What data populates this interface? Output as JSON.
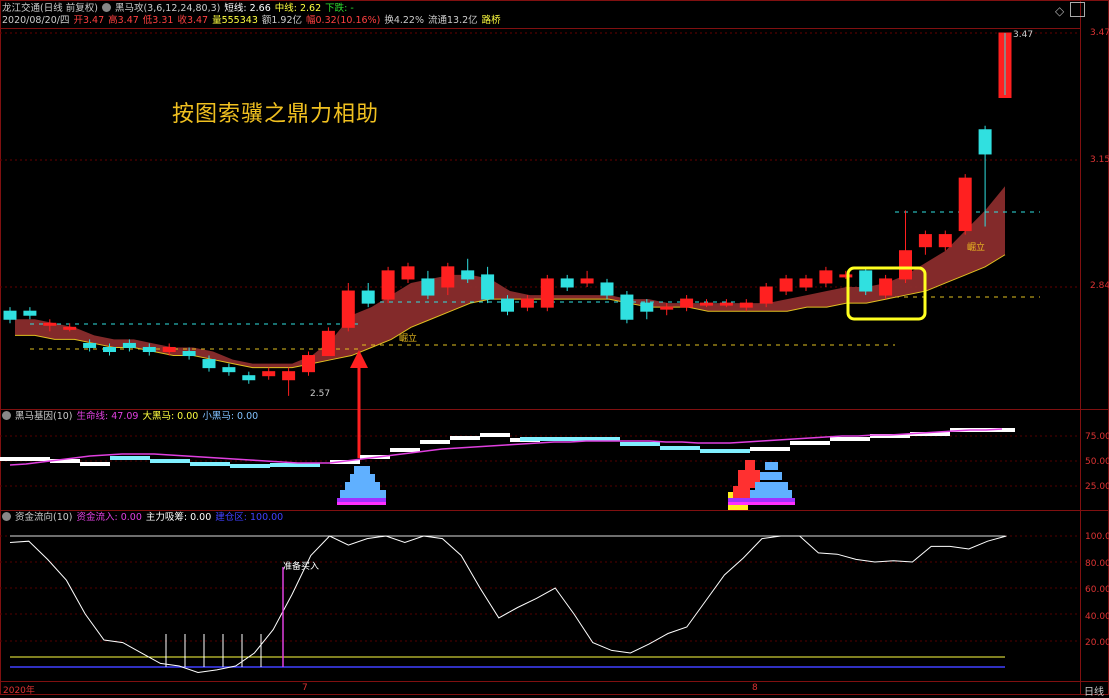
{
  "header": {
    "title": "龙江交通(日线 前复权)",
    "indicator": "黑马攻(3,6,12,24,80,3)",
    "short_line": "短线: 2.66",
    "mid_line": "中线: 2.62",
    "trend": "下跌: -",
    "date": "2020/08/20/四",
    "open": "开3.47",
    "high": "高3.47",
    "low": "低3.31",
    "close": "收3.47",
    "volume": "量555343",
    "amount": "额1.92亿",
    "amp": "幅0.32(10.16%)",
    "turnover": "换4.22%",
    "float": "流通13.2亿",
    "extra": "路桥"
  },
  "annotation": "按图索骥之鼎力相助",
  "price_axis": [
    "3.47",
    "3.15",
    "2.84"
  ],
  "price_labels": {
    "high": "3.47",
    "low": "2.57",
    "rise1": "崛立",
    "rise2": "崛立"
  },
  "panel2": {
    "title": "黑马基因(10)",
    "l1": "生命线: 47.09",
    "l2": "大黑马: 0.00",
    "l3": "小黑马: 0.00",
    "axis": [
      "75.00",
      "50.00",
      "25.00"
    ]
  },
  "panel3": {
    "title": "资金流向(10)",
    "l1": "资金流入: 0.00",
    "l2": "主力吸筹: 0.00",
    "l3": "建仓区: 100.00",
    "axis": [
      "100.00",
      "80.00",
      "60.00",
      "40.00",
      "20.00"
    ],
    "note": "准备买入"
  },
  "x_axis": [
    "2020年",
    "7",
    "8"
  ],
  "period_label": "日线",
  "colors": {
    "up": "#ff2020",
    "down": "#30e0e0",
    "ma": "#a04040",
    "grid": "#801010"
  },
  "chart_data": {
    "type": "candlestick",
    "ylim": [
      2.45,
      3.5
    ],
    "candles": [
      {
        "o": 2.78,
        "c": 2.76,
        "h": 2.79,
        "l": 2.75
      },
      {
        "o": 2.78,
        "c": 2.77,
        "h": 2.79,
        "l": 2.76
      },
      {
        "o": 2.75,
        "c": 2.75,
        "h": 2.76,
        "l": 2.73
      },
      {
        "o": 2.74,
        "c": 2.74,
        "h": 2.75,
        "l": 2.73
      },
      {
        "o": 2.7,
        "c": 2.69,
        "h": 2.71,
        "l": 2.68
      },
      {
        "o": 2.69,
        "c": 2.68,
        "h": 2.7,
        "l": 2.67
      },
      {
        "o": 2.7,
        "c": 2.69,
        "h": 2.71,
        "l": 2.68
      },
      {
        "o": 2.69,
        "c": 2.68,
        "h": 2.7,
        "l": 2.67
      },
      {
        "o": 2.68,
        "c": 2.69,
        "h": 2.7,
        "l": 2.67
      },
      {
        "o": 2.68,
        "c": 2.67,
        "h": 2.69,
        "l": 2.66
      },
      {
        "o": 2.66,
        "c": 2.64,
        "h": 2.67,
        "l": 2.63
      },
      {
        "o": 2.64,
        "c": 2.63,
        "h": 2.65,
        "l": 2.62
      },
      {
        "o": 2.62,
        "c": 2.61,
        "h": 2.63,
        "l": 2.6
      },
      {
        "o": 2.62,
        "c": 2.63,
        "h": 2.64,
        "l": 2.61
      },
      {
        "o": 2.61,
        "c": 2.63,
        "h": 2.64,
        "l": 2.57
      },
      {
        "o": 2.63,
        "c": 2.67,
        "h": 2.68,
        "l": 2.62
      },
      {
        "o": 2.67,
        "c": 2.73,
        "h": 2.74,
        "l": 2.67
      },
      {
        "o": 2.74,
        "c": 2.83,
        "h": 2.85,
        "l": 2.73
      },
      {
        "o": 2.83,
        "c": 2.8,
        "h": 2.85,
        "l": 2.79
      },
      {
        "o": 2.81,
        "c": 2.88,
        "h": 2.89,
        "l": 2.8
      },
      {
        "o": 2.86,
        "c": 2.89,
        "h": 2.9,
        "l": 2.85
      },
      {
        "o": 2.86,
        "c": 2.82,
        "h": 2.88,
        "l": 2.81
      },
      {
        "o": 2.84,
        "c": 2.89,
        "h": 2.9,
        "l": 2.82
      },
      {
        "o": 2.88,
        "c": 2.86,
        "h": 2.91,
        "l": 2.85
      },
      {
        "o": 2.87,
        "c": 2.81,
        "h": 2.89,
        "l": 2.8
      },
      {
        "o": 2.81,
        "c": 2.78,
        "h": 2.82,
        "l": 2.77
      },
      {
        "o": 2.79,
        "c": 2.81,
        "h": 2.82,
        "l": 2.78
      },
      {
        "o": 2.79,
        "c": 2.86,
        "h": 2.87,
        "l": 2.78
      },
      {
        "o": 2.86,
        "c": 2.84,
        "h": 2.87,
        "l": 2.83
      },
      {
        "o": 2.85,
        "c": 2.86,
        "h": 2.88,
        "l": 2.84
      },
      {
        "o": 2.85,
        "c": 2.82,
        "h": 2.86,
        "l": 2.81
      },
      {
        "o": 2.82,
        "c": 2.76,
        "h": 2.83,
        "l": 2.75
      },
      {
        "o": 2.8,
        "c": 2.78,
        "h": 2.81,
        "l": 2.76
      },
      {
        "o": 2.79,
        "c": 2.79,
        "h": 2.8,
        "l": 2.77
      },
      {
        "o": 2.79,
        "c": 2.81,
        "h": 2.82,
        "l": 2.78
      },
      {
        "o": 2.8,
        "c": 2.8,
        "h": 2.81,
        "l": 2.79
      },
      {
        "o": 2.8,
        "c": 2.8,
        "h": 2.81,
        "l": 2.79
      },
      {
        "o": 2.79,
        "c": 2.8,
        "h": 2.81,
        "l": 2.78
      },
      {
        "o": 2.8,
        "c": 2.84,
        "h": 2.85,
        "l": 2.79
      },
      {
        "o": 2.83,
        "c": 2.86,
        "h": 2.87,
        "l": 2.82
      },
      {
        "o": 2.84,
        "c": 2.86,
        "h": 2.87,
        "l": 2.83
      },
      {
        "o": 2.85,
        "c": 2.88,
        "h": 2.89,
        "l": 2.84
      },
      {
        "o": 2.87,
        "c": 2.87,
        "h": 2.88,
        "l": 2.86
      },
      {
        "o": 2.88,
        "c": 2.83,
        "h": 2.89,
        "l": 2.82
      },
      {
        "o": 2.82,
        "c": 2.86,
        "h": 2.87,
        "l": 2.81
      },
      {
        "o": 2.86,
        "c": 2.93,
        "h": 3.03,
        "l": 2.85
      },
      {
        "o": 2.94,
        "c": 2.97,
        "h": 2.98,
        "l": 2.92
      },
      {
        "o": 2.94,
        "c": 2.97,
        "h": 2.98,
        "l": 2.93
      },
      {
        "o": 2.98,
        "c": 3.11,
        "h": 3.12,
        "l": 2.97
      },
      {
        "o": 3.23,
        "c": 3.17,
        "h": 3.24,
        "l": 2.99
      },
      {
        "o": 3.31,
        "c": 3.47,
        "h": 3.47,
        "l": 3.31
      }
    ],
    "rise_band": [
      [
        2.76,
        2.72
      ],
      [
        2.76,
        2.72
      ],
      [
        2.75,
        2.71
      ],
      [
        2.74,
        2.71
      ],
      [
        2.72,
        2.7
      ],
      [
        2.71,
        2.69
      ],
      [
        2.71,
        2.69
      ],
      [
        2.7,
        2.68
      ],
      [
        2.69,
        2.67
      ],
      [
        2.69,
        2.67
      ],
      [
        2.68,
        2.66
      ],
      [
        2.66,
        2.65
      ],
      [
        2.65,
        2.64
      ],
      [
        2.65,
        2.64
      ],
      [
        2.65,
        2.64
      ],
      [
        2.67,
        2.65
      ],
      [
        2.71,
        2.66
      ],
      [
        2.77,
        2.67
      ],
      [
        2.79,
        2.69
      ],
      [
        2.82,
        2.71
      ],
      [
        2.85,
        2.74
      ],
      [
        2.86,
        2.76
      ],
      [
        2.87,
        2.78
      ],
      [
        2.87,
        2.8
      ],
      [
        2.86,
        2.81
      ],
      [
        2.83,
        2.81
      ],
      [
        2.82,
        2.81
      ],
      [
        2.82,
        2.81
      ],
      [
        2.82,
        2.81
      ],
      [
        2.82,
        2.81
      ],
      [
        2.82,
        2.81
      ],
      [
        2.81,
        2.8
      ],
      [
        2.81,
        2.79
      ],
      [
        2.8,
        2.79
      ],
      [
        2.8,
        2.79
      ],
      [
        2.8,
        2.78
      ],
      [
        2.8,
        2.78
      ],
      [
        2.8,
        2.78
      ],
      [
        2.8,
        2.78
      ],
      [
        2.81,
        2.78
      ],
      [
        2.82,
        2.79
      ],
      [
        2.83,
        2.79
      ],
      [
        2.84,
        2.8
      ],
      [
        2.84,
        2.8
      ],
      [
        2.85,
        2.81
      ],
      [
        2.87,
        2.82
      ],
      [
        2.9,
        2.83
      ],
      [
        2.93,
        2.85
      ],
      [
        2.98,
        2.87
      ],
      [
        3.03,
        2.89
      ],
      [
        3.09,
        2.92
      ]
    ],
    "panel2_life": [
      46,
      47,
      49,
      51,
      53,
      55,
      56,
      57,
      57,
      57,
      56,
      55,
      54,
      53,
      52,
      51,
      50,
      49,
      48,
      48,
      48,
      50,
      52,
      54,
      56,
      58,
      60,
      62,
      63,
      64,
      65,
      66,
      67,
      68,
      69,
      69,
      70,
      70,
      70,
      70,
      70,
      69,
      69,
      68,
      68,
      68,
      69,
      70,
      71,
      72,
      73,
      74,
      75,
      75,
      76,
      76,
      77,
      78,
      79,
      80,
      81,
      81,
      82
    ],
    "panel3_line": [
      95,
      96,
      82,
      66,
      40,
      20,
      18,
      10,
      2,
      0,
      -5,
      -3,
      0,
      10,
      28,
      55,
      85,
      100,
      93,
      98,
      100,
      95,
      100,
      98,
      85,
      60,
      37,
      45,
      52,
      60,
      40,
      18,
      12,
      10,
      17,
      25,
      30,
      50,
      70,
      83,
      98,
      100,
      100,
      87,
      86,
      82,
      80,
      81,
      80,
      92,
      92,
      90,
      96,
      100
    ]
  }
}
